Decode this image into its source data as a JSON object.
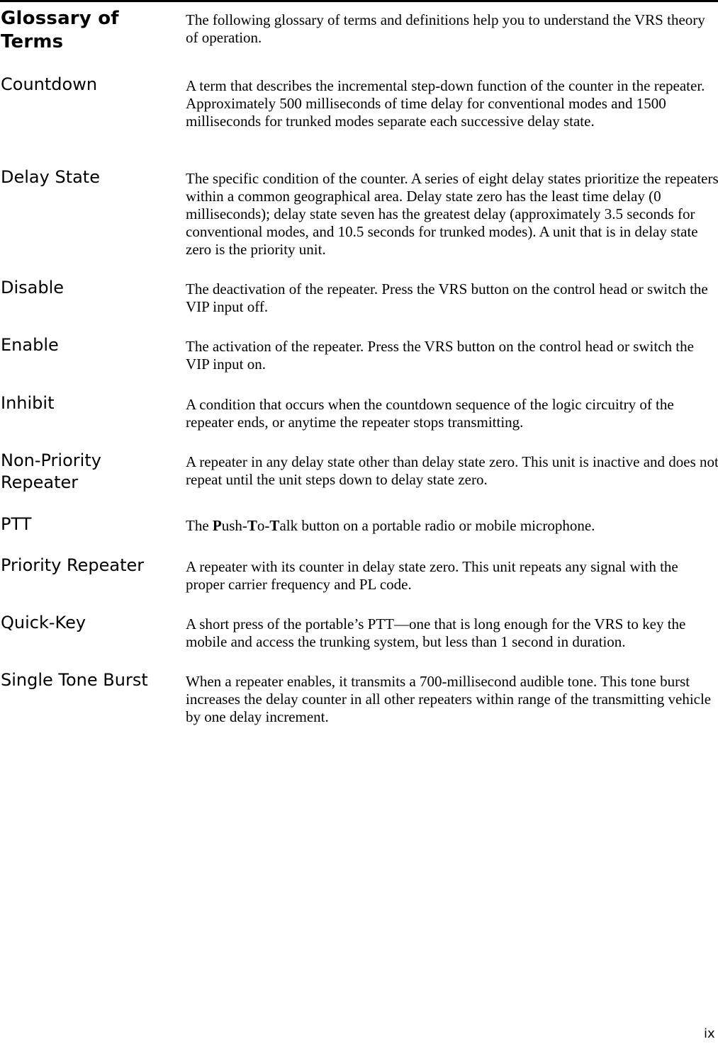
{
  "header": {
    "title": "Glossary of Terms",
    "intro": "The following glossary of terms and definitions help you to understand the VRS theory of operation."
  },
  "entries": [
    {
      "term": "Countdown",
      "definition": "A term that describes the incremental step-down function of the counter in the repeater. Approximately 500 milliseconds of time delay for conventional modes and 1500 milliseconds for trunked modes separate each successive delay state."
    },
    {
      "term": "Delay State",
      "definition": "The specific condition of the counter. A series of eight delay states prioritize the repeaters within a common geographical area. Delay state zero has the least time delay (0 milliseconds); delay state seven has the greatest delay (approximately 3.5 seconds for conventional modes, and 10.5 seconds for trunked modes). A unit that is in delay state zero is the priority unit."
    },
    {
      "term": "Disable",
      "definition": "The deactivation of the repeater. Press the VRS button on the control head or switch the VIP input off."
    },
    {
      "term": "Enable",
      "definition": "The activation of the repeater. Press the VRS button on the control head or switch the VIP input on."
    },
    {
      "term": "Inhibit",
      "definition": "A condition that occurs when the countdown sequence of the logic circuitry of the repeater ends, or anytime the repeater stops transmitting."
    },
    {
      "term": "Non-Priority Repeater",
      "definition": "A repeater in any delay state other than delay state zero. This unit is inactive and does not repeat until the unit steps down to delay state zero."
    },
    {
      "term": "PTT",
      "definition_parts": [
        "The ",
        "P",
        "ush-",
        "T",
        "o-",
        "T",
        "alk button on a portable radio or mobile microphone."
      ]
    },
    {
      "term": "Priority Repeater",
      "definition": "A repeater with its counter in delay state zero. This unit repeats any signal with the proper carrier frequency and PL code."
    },
    {
      "term": "Quick-Key",
      "definition": "A short press of the portable’s PTT—one that is long enough for the VRS to key the mobile and access the trunking system, but less than 1 second in duration."
    },
    {
      "term": "Single Tone Burst",
      "definition": "When a repeater enables, it transmits a 700-millisecond audible tone. This tone burst increases the delay counter in all other repeaters within range of the transmitting vehicle by one delay increment."
    }
  ],
  "footer": {
    "page_number": "ix"
  }
}
